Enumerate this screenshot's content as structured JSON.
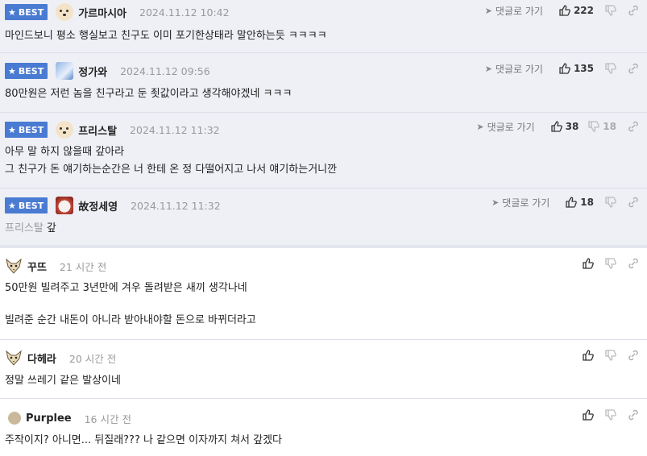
{
  "labels": {
    "best": "BEST",
    "reply": "댓글로 가기"
  },
  "best_comments": [
    {
      "author": "가르마시아",
      "avatar": "puppy-avatar",
      "date": "2024.11.12 10:42",
      "text": "마인드보니 평소 행실보고 친구도 이미 포기한상태라 말안하는듯 ㅋㅋㅋㅋ",
      "likes": "222",
      "dislikes": ""
    },
    {
      "author": "정가와",
      "avatar": "blue-avatar",
      "date": "2024.11.12 09:56",
      "text": "80만원은 저런 놈을 친구라고 둔 죗값이라고 생각해야겠네 ㅋㅋㅋ",
      "likes": "135",
      "dislikes": ""
    },
    {
      "author": "프리스탈",
      "avatar": "puppy-avatar",
      "date": "2024.11.12 11:32",
      "text": "아무 말 하지 않을때 갚아라\n그 친구가 돈 얘기하는순간은 너 한테 온 정 다떨어지고 나서 얘기하는거니깐",
      "likes": "38",
      "dislikes": "18"
    },
    {
      "author": "故정세영",
      "avatar": "clown-avatar",
      "date": "2024.11.12 11:32",
      "reply_to": "프리스탈",
      "text": "갚",
      "likes": "18",
      "dislikes": ""
    }
  ],
  "comments": [
    {
      "author": "꾸뜨",
      "avatar": "fox-avatar",
      "date": "21 시간 전",
      "text": "50만원 빌려주고 3년만에 겨우 돌려받은 새끼 생각나네\n\n빌려준 순간 내돈이 아니라 받아내야할 돈으로 바뀌더라고"
    },
    {
      "author": "다헤라",
      "avatar": "fox-avatar",
      "date": "20 시간 전",
      "text": "정말 쓰레기 같은 발상이네"
    },
    {
      "author": "Purplee",
      "avatar": "circle-avatar",
      "date": "16 시간 전",
      "text": "주작이지? 아니면... 뒤질래??? 나 같으면 이자까지 쳐서 갚겠다"
    }
  ]
}
